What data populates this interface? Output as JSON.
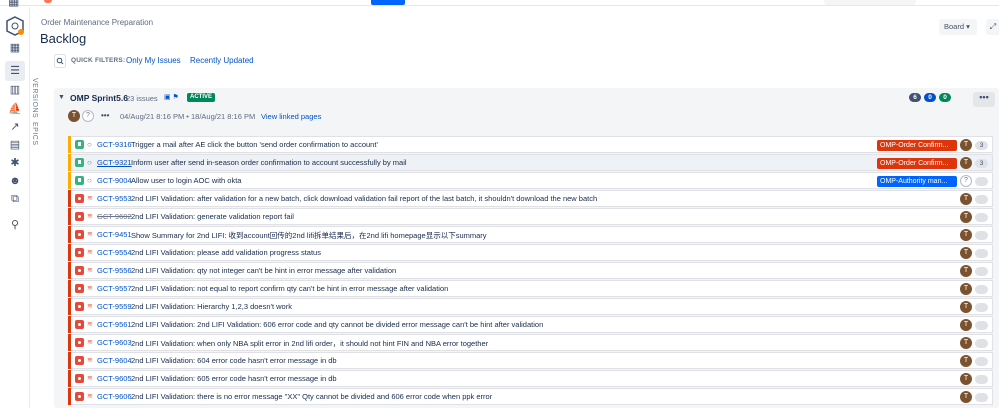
{
  "topbar": {
    "menu_icon": "menu-grid-icon"
  },
  "leftnav": {
    "items": [
      {
        "name": "project-logo",
        "glyph": ""
      },
      {
        "name": "roadmap-icon",
        "glyph": "▦"
      },
      {
        "name": "backlog-icon",
        "glyph": "☰"
      },
      {
        "name": "board-icon",
        "glyph": "▥"
      },
      {
        "name": "releases-icon",
        "glyph": "⛵"
      },
      {
        "name": "reports-icon",
        "glyph": "↗"
      },
      {
        "name": "issues-icon",
        "glyph": "▤"
      },
      {
        "name": "components-icon",
        "glyph": "✱"
      },
      {
        "name": "people-icon",
        "glyph": "☻"
      },
      {
        "name": "pages-icon",
        "glyph": "⧉"
      },
      {
        "name": "link-icon",
        "glyph": "⚲"
      }
    ]
  },
  "side_tabs": {
    "versions": "VERSIONS",
    "epics": "EPICS"
  },
  "header": {
    "breadcrumb": "Order Maintenance Preparation",
    "title": "Backlog",
    "board_button": "Board ▾",
    "expand_button": "⤢"
  },
  "filters": {
    "label": "QUICK FILTERS:",
    "items": [
      "Only My Issues",
      "Recently Updated"
    ]
  },
  "sprint": {
    "name": "OMP Sprint5.6",
    "count": "23 issues",
    "status": "ACTIVE",
    "dates": "04/Aug/21 8:16 PM  •  18/Aug/21 8:16 PM",
    "link": "View linked pages",
    "counts": [
      {
        "value": "6",
        "color": "#42526e"
      },
      {
        "value": "0",
        "color": "#0052cc"
      },
      {
        "value": "0",
        "color": "#00875a"
      }
    ],
    "more": "•••"
  },
  "issues": [
    {
      "type": "story",
      "key": "GCT-9316",
      "summary": "Trigger a mail after AE click the button 'send order confirmation to account'",
      "epic": "OMP-Order Confirm...",
      "epic_color": "red",
      "assignee": "T",
      "points": "3",
      "selected": false,
      "done": false
    },
    {
      "type": "story",
      "key": "GCT-9321",
      "summary": "Inform user after send in-season order confirmation to account successfully by mail",
      "epic": "OMP-Order Confirm...",
      "epic_color": "red",
      "assignee": "T",
      "points": "3",
      "selected": true,
      "done": false
    },
    {
      "type": "story",
      "key": "GCT-9004",
      "summary": "Allow user to login AOC with okta",
      "epic": "OMP-Authority man...",
      "epic_color": "blue",
      "assignee": "?",
      "points": "",
      "selected": false,
      "done": false
    },
    {
      "type": "bug",
      "key": "GCT-9553",
      "summary": "2nd LIFI Validation: after validation for a new batch, click download validation fail report of the last batch, it shouldn't download the new batch",
      "epic": "",
      "assignee": "T",
      "points": "",
      "selected": false,
      "done": false
    },
    {
      "type": "bug",
      "key": "GCT-9602",
      "summary": "2nd LIFI Validation: generate validation report fail",
      "epic": "",
      "assignee": "T",
      "points": "",
      "selected": false,
      "done": true
    },
    {
      "type": "bug",
      "key": "GCT-9451",
      "summary": "Show Summary for 2nd LIFI: 收到account回传的2nd lifi拆单结果后，在2nd lifi homepage显示以下summary",
      "epic": "",
      "assignee": "T",
      "points": "",
      "selected": false,
      "done": false
    },
    {
      "type": "bug",
      "key": "GCT-9554",
      "summary": "2nd LIFI Validation: please add validation progress status",
      "epic": "",
      "assignee": "T",
      "points": "",
      "selected": false,
      "done": false
    },
    {
      "type": "bug",
      "key": "GCT-9556",
      "summary": "2nd LIFI Validation: qty not integer can't be hint in error message after validation",
      "epic": "",
      "assignee": "T",
      "points": "",
      "selected": false,
      "done": false
    },
    {
      "type": "bug",
      "key": "GCT-9557",
      "summary": "2nd LIFI Validation: not equal to report confirm qty can't be hint in error message after validation",
      "epic": "",
      "assignee": "T",
      "points": "",
      "selected": false,
      "done": false
    },
    {
      "type": "bug",
      "key": "GCT-9559",
      "summary": "2nd LIFI Validation: Hierarchy 1,2,3 doesn't work",
      "epic": "",
      "assignee": "T",
      "points": "",
      "selected": false,
      "done": false
    },
    {
      "type": "bug",
      "key": "GCT-9561",
      "summary": "2nd LIFI Validation: 2nd LIFI Validation: 606 error code and qty cannot be divided error message can't be hint after validation",
      "epic": "",
      "assignee": "T",
      "points": "",
      "selected": false,
      "done": false
    },
    {
      "type": "bug",
      "key": "GCT-9603",
      "summary": "2nd LIFI Validation: when only NBA split error in 2nd lifi order，it should not hint FIN and NBA error together",
      "epic": "",
      "assignee": "T",
      "points": "",
      "selected": false,
      "done": false
    },
    {
      "type": "bug",
      "key": "GCT-9604",
      "summary": "2nd LIFI Validation: 604 error code hasn't error message in db",
      "epic": "",
      "assignee": "T",
      "points": "",
      "selected": false,
      "done": false
    },
    {
      "type": "bug",
      "key": "GCT-9605",
      "summary": "2nd LIFI Validation: 605 error code hasn't error message in db",
      "epic": "",
      "assignee": "T",
      "points": "",
      "selected": false,
      "done": false
    },
    {
      "type": "bug",
      "key": "GCT-9606",
      "summary": "2nd LIFI Validation: there is no error message \"XX\" Qty cannot be divided and 606 error code when ppk error",
      "epic": "",
      "assignee": "T",
      "points": "",
      "selected": false,
      "done": false
    }
  ]
}
